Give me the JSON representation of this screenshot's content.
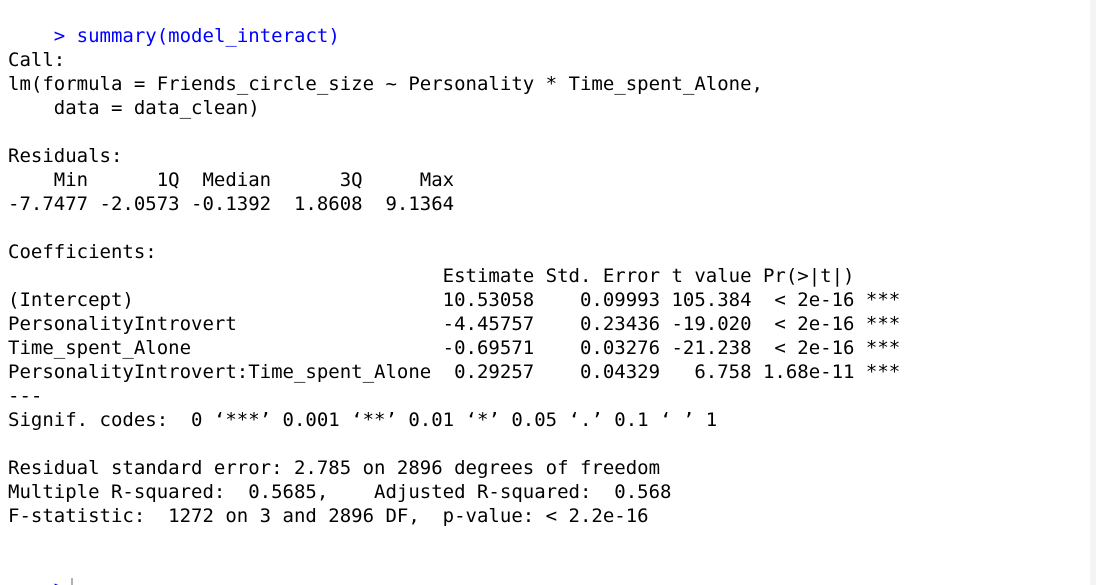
{
  "console": {
    "prompt": ">",
    "command": "summary(model_interact)",
    "output": [
      "Call:",
      "lm(formula = Friends_circle_size ~ Personality * Time_spent_Alone,",
      "    data = data_clean)",
      "",
      "Residuals:",
      "    Min      1Q  Median      3Q     Max ",
      "-7.7477 -2.0573 -0.1392  1.8608  9.1364 ",
      "",
      "Coefficients:",
      "                                      Estimate Std. Error t value Pr(>|t|)    ",
      "(Intercept)                           10.53058    0.09993 105.384  < 2e-16 ***",
      "PersonalityIntrovert                  -4.45757    0.23436 -19.020  < 2e-16 ***",
      "Time_spent_Alone                      -0.69571    0.03276 -21.238  < 2e-16 ***",
      "PersonalityIntrovert:Time_spent_Alone  0.29257    0.04329   6.758 1.68e-11 ***",
      "---",
      "Signif. codes:  0 ‘***’ 0.001 ‘**’ 0.01 ‘*’ 0.05 ‘.’ 0.1 ‘ ’ 1",
      "",
      "Residual standard error: 2.785 on 2896 degrees of freedom",
      "Multiple R-squared:  0.5685,\tAdjusted R-squared:  0.568 ",
      "F-statistic:  1272 on 3 and 2896 DF,  p-value: < 2.2e-16"
    ]
  }
}
